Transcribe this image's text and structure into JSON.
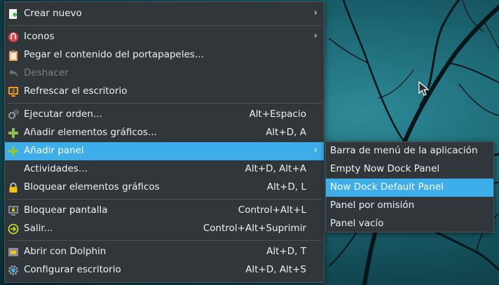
{
  "menu": {
    "items": [
      {
        "label": "Crear nuevo",
        "shortcut": "",
        "arrow": "›",
        "icon": "new-document-icon"
      },
      {
        "label": "Iconos",
        "shortcut": "",
        "arrow": "›",
        "icon": "icons-icon"
      },
      {
        "label": "Pegar el contenido del portapapeles...",
        "shortcut": "",
        "arrow": "",
        "icon": "paste-icon"
      },
      {
        "label": "Deshacer",
        "shortcut": "",
        "arrow": "",
        "icon": "undo-icon"
      },
      {
        "label": "Refrescar el escritorio",
        "shortcut": "",
        "arrow": "",
        "icon": "refresh-desktop-icon"
      },
      {
        "label": "Ejecutar orden...",
        "shortcut": "Alt+Espacio",
        "arrow": "",
        "icon": "run-command-icon"
      },
      {
        "label": "Añadir elementos gráficos...",
        "shortcut": "Alt+D, A",
        "arrow": "",
        "icon": "add-widgets-icon"
      },
      {
        "label": "Añadir panel",
        "shortcut": "",
        "arrow": "›",
        "icon": "add-panel-icon"
      },
      {
        "label": "Actividades...",
        "shortcut": "Alt+D, Alt+A",
        "arrow": "",
        "icon": "activities-icon"
      },
      {
        "label": "Bloquear elementos gráficos",
        "shortcut": "Alt+D, L",
        "arrow": "",
        "icon": "lock-icon"
      },
      {
        "label": "Bloquear pantalla",
        "shortcut": "Control+Alt+L",
        "arrow": "",
        "icon": "lock-screen-icon"
      },
      {
        "label": "Salir...",
        "shortcut": "Control+Alt+Suprimir",
        "arrow": "",
        "icon": "logout-icon"
      },
      {
        "label": "Abrir con Dolphin",
        "shortcut": "Alt+D, T",
        "arrow": "",
        "icon": "folder-icon"
      },
      {
        "label": "Configurar escritorio",
        "shortcut": "Alt+D, Alt+S",
        "arrow": "",
        "icon": "settings-icon"
      }
    ]
  },
  "submenu": {
    "items": [
      {
        "label": "Barra de menú de la aplicación"
      },
      {
        "label": "Empty Now Dock Panel"
      },
      {
        "label": "Now Dock Default Panel"
      },
      {
        "label": "Panel por omisión"
      },
      {
        "label": "Panel vacío"
      }
    ]
  },
  "colors": {
    "menu_bg": "#31363b",
    "highlight": "#3daee9",
    "text": "#eff0f1",
    "disabled_text": "#7b8085"
  }
}
